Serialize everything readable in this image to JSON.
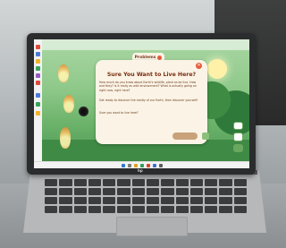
{
  "scene": {
    "description_colors": {
      "wall": "#c5c9ca",
      "lid": "#2b2c2e",
      "deck": "#b7b8ba",
      "app_bg": "#8fc98a",
      "dialog_bg": "#fbf4e6",
      "accent": "#e45b3d"
    }
  },
  "app": {
    "tab_label": "Problems",
    "dialog": {
      "title": "Sure You Want to Live Here?",
      "paragraph_1": "How much do you know about Earth's wildlife, plant as be live, How and they? Is it really as wild environment? What is actually going on right now, right here?",
      "paragraph_2": "Get ready to discover the reality of our Earth, then discover yourself!",
      "paragraph_3": "Sure you want to live here?",
      "close_icon": "close-icon"
    }
  },
  "laptop": {
    "brand": "hp"
  }
}
